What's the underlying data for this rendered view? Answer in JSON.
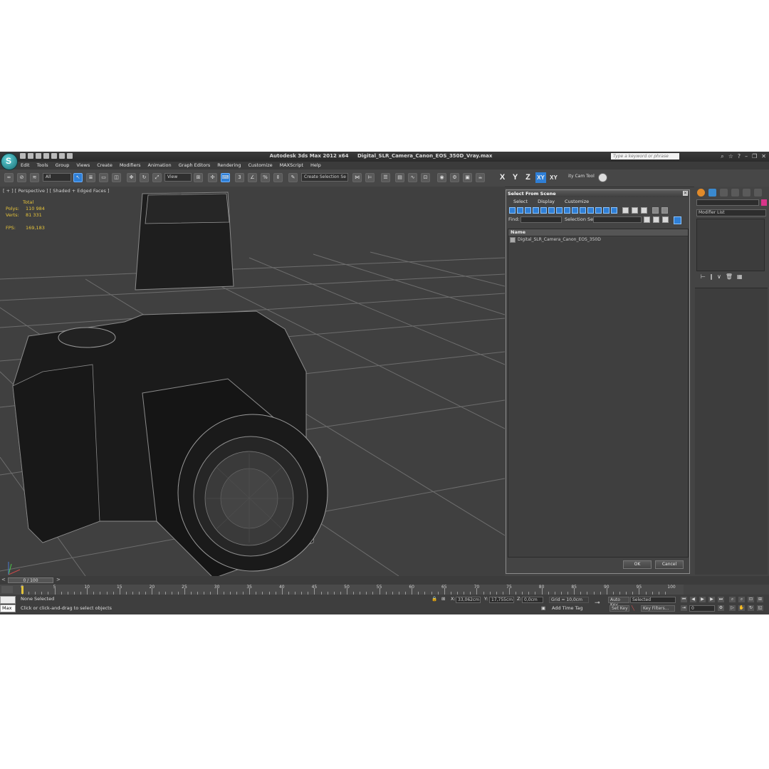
{
  "app": {
    "title": "Autodesk 3ds Max  2012 x64",
    "filename": "Digital_SLR_Camera_Canon_EOS_350D_Vray.max",
    "search_placeholder": "Type a keyword or phrase"
  },
  "menu": [
    "Edit",
    "Tools",
    "Group",
    "Views",
    "Create",
    "Modifiers",
    "Animation",
    "Graph Editors",
    "Rendering",
    "Customize",
    "MAXScript",
    "Help"
  ],
  "toolbar": {
    "selection_filter": "All",
    "reference_coord": "View",
    "named_selection": "Create Selection Se",
    "axes": [
      "X",
      "Y",
      "Z",
      "XY",
      "XY"
    ],
    "active_axis": "XY",
    "cam_tool": "ity Cam Tool"
  },
  "viewport": {
    "label": "[ + ] [ Perspective ] [ Shaded + Edged Faces ]",
    "stats_header": "Total",
    "polys_label": "Polys:",
    "polys_value": "110 984",
    "verts_label": "Verts:",
    "verts_value": "81 331",
    "fps_label": "FPS:",
    "fps_value": "169,183",
    "axis_tripod_icon": "xyz-axis-icon"
  },
  "dialog": {
    "title": "Select From Scene",
    "menu": [
      "Select",
      "Display",
      "Customize"
    ],
    "find_label": "Find:",
    "selection_set_label": "Selection Set:",
    "column_name": "Name",
    "objects": [
      "Digital_SLR_Camera_Canon_EOS_350D"
    ],
    "ok": "OK",
    "cancel": "Cancel"
  },
  "command_panel": {
    "modifier_list": "Modifier List",
    "object_color": "#d8358a"
  },
  "timeline": {
    "frame_display": "0 / 100",
    "ticks": [
      "0",
      "5",
      "10",
      "15",
      "20",
      "25",
      "30",
      "35",
      "40",
      "45",
      "50",
      "55",
      "60",
      "65",
      "70",
      "75",
      "80",
      "85",
      "90",
      "95",
      "100"
    ]
  },
  "status": {
    "maxscript_label": "Max",
    "selection": "None Selected",
    "prompt": "Click or click-and-drag to select objects",
    "x_label": "X:",
    "x_value": "33,062cm",
    "y_label": "Y:",
    "y_value": "17,755cm",
    "z_label": "Z:",
    "z_value": "0,0cm",
    "grid": "Grid = 10,0cm",
    "add_time_tag": "Add Time Tag",
    "auto_key": "Auto Key",
    "set_key": "Set Key",
    "key_mode": "Selected",
    "key_filters": "Key Filters...",
    "current_frame": "0"
  }
}
